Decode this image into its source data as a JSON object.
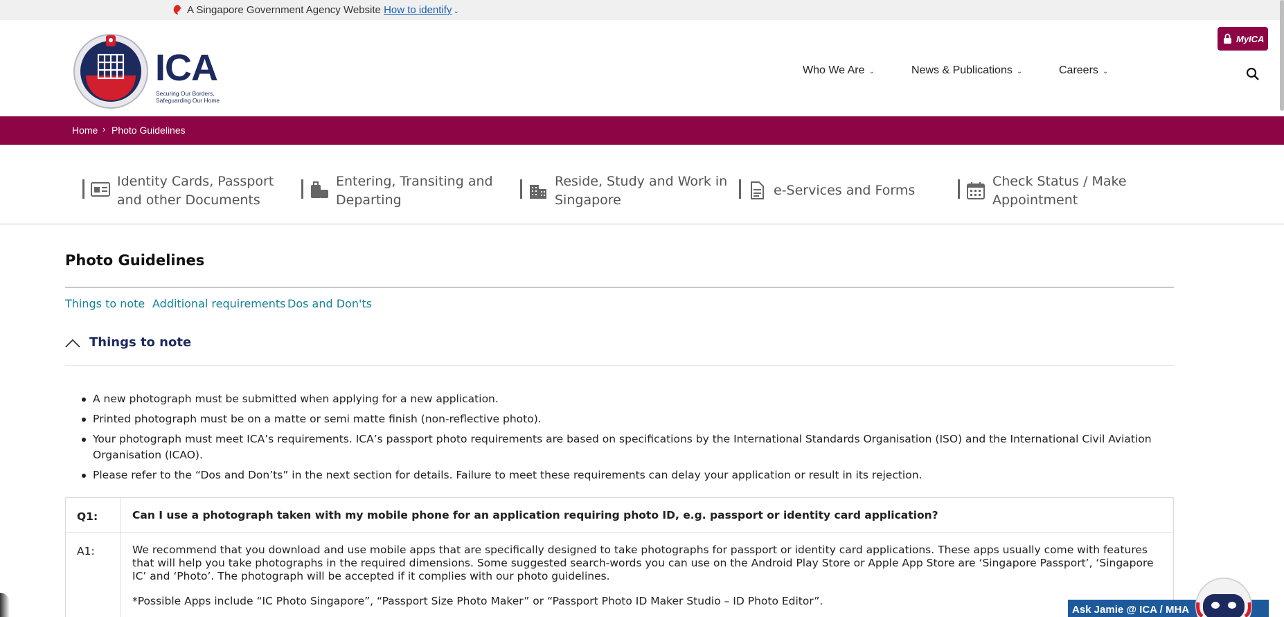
{
  "govbar": {
    "text": "A Singapore Government Agency Website",
    "link": "How to identify"
  },
  "logo": {
    "name": "ICA",
    "tagline_1": "Securing Our Borders,",
    "tagline_2": "Safeguarding Our Home"
  },
  "header": {
    "myica_label": "MyICA",
    "nav": [
      {
        "label": "Who We Are"
      },
      {
        "label": "News & Publications"
      },
      {
        "label": "Careers"
      }
    ]
  },
  "breadcrumb": {
    "home": "Home",
    "separator": "›",
    "current": "Photo Guidelines"
  },
  "categories": [
    {
      "line1": "Identity Cards, Passport",
      "line2": "and other Documents",
      "icon": "id-card-icon"
    },
    {
      "line1": "Entering, Transiting and",
      "line2": "Departing",
      "icon": "luggage-icon"
    },
    {
      "line1": "Reside, Study and Work in",
      "line2": "Singapore",
      "icon": "building-icon"
    },
    {
      "line1": "e-Services and Forms",
      "line2": "",
      "icon": "document-icon"
    },
    {
      "line1": "Check Status / Make",
      "line2": "Appointment",
      "icon": "calendar-icon"
    }
  ],
  "page": {
    "title": "Photo Guidelines",
    "anchors": [
      "Things to note",
      "Additional requirements",
      "Dos and Don'ts"
    ],
    "section_title": "Things to note",
    "bullets": [
      "A new photograph must be submitted when applying for a new application.",
      "Printed photograph must be on a matte or semi matte finish (non-reflective photo).",
      "Your photograph must meet ICA’s requirements. ICA’s passport photo requirements are based on specifications by the International Standards Organisation (ISO) and the International Civil Aviation Organisation (ICAO).",
      "Please refer to the “Dos and Don’ts” in the next section for details. Failure to meet these requirements can delay your application or result in its rejection."
    ],
    "faq": {
      "q1_key": "Q1:",
      "q1": "Can I use a photograph taken with my mobile phone for an application requiring photo ID, e.g. passport or identity card application?",
      "a1_key": "A1:",
      "a1_p1": "We recommend that you download and use mobile apps that are specifically designed to take photographs for passport or identity card applications. These apps usually come with features that will help you take photographs in the required dimensions. Some suggested search-words you can use on the Android Play Store or Apple App Store are ‘Singapore Passport’, ‘Singapore IC’ and ‘Photo’. The photograph will be accepted if it complies with our photo guidelines.",
      "a1_p2": "*Possible Apps include  “IC Photo Singapore”, “Passport Size Photo Maker” or “Passport Photo ID Maker Studio – ID Photo Editor”."
    }
  },
  "chat": {
    "label": "Ask Jamie @ ICA / MHA"
  },
  "colors": {
    "brand": "#8e0545",
    "navy": "#1d2a5e",
    "link": "#17809b",
    "chat": "#1d5a9c"
  }
}
